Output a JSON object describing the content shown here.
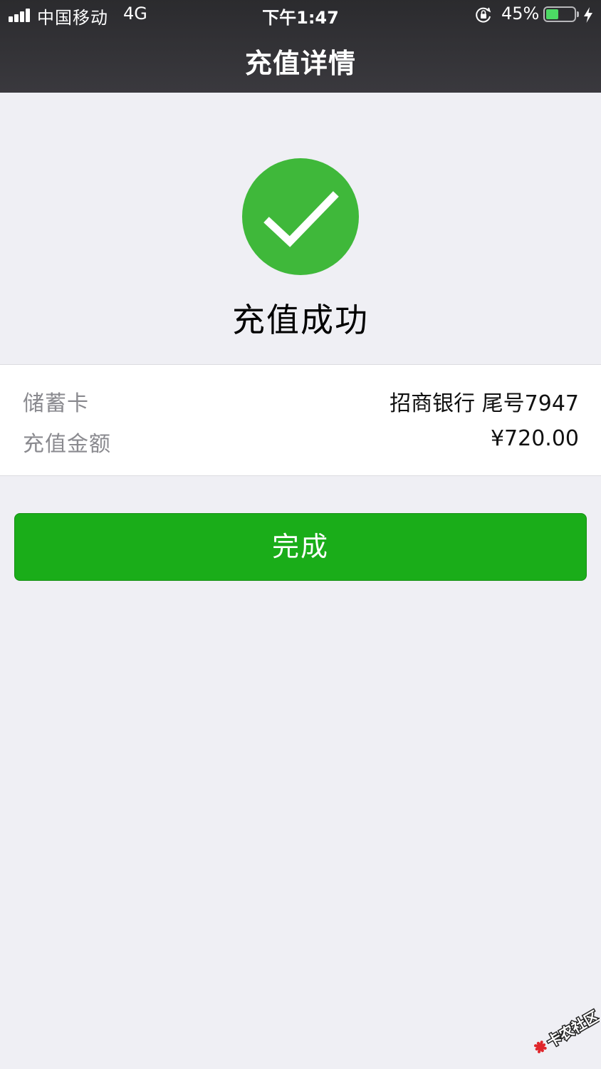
{
  "status_bar": {
    "carrier": "中国移动",
    "network": "4G",
    "time": "下午1:47",
    "battery_percent": "45%",
    "battery_level": 0.45,
    "icons": [
      "signal-bars-icon",
      "orientation-lock-icon",
      "battery-icon",
      "charging-bolt-icon"
    ]
  },
  "nav": {
    "title": "充值详情"
  },
  "result": {
    "icon": "checkmark-icon",
    "icon_color": "#3fb83a",
    "message": "充值成功"
  },
  "details": [
    {
      "label": "储蓄卡",
      "value": "招商银行 尾号7947"
    },
    {
      "label": "充值金额",
      "value": "¥720.00"
    }
  ],
  "actions": {
    "done_label": "完成",
    "done_color": "#1aad19"
  },
  "watermark": {
    "text": "卡农社区"
  }
}
